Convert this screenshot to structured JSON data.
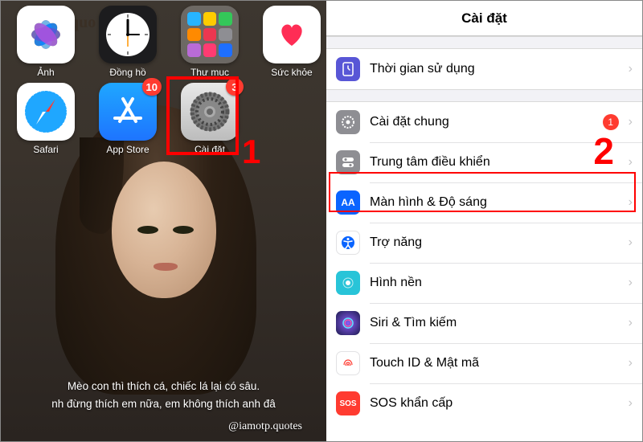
{
  "left": {
    "overlay_text": "quo",
    "apps_row1": [
      {
        "label": "Ảnh",
        "name": "photos"
      },
      {
        "label": "Đồng hồ",
        "name": "clock"
      },
      {
        "label": "Thư mục",
        "name": "folder"
      },
      {
        "label": "Sức khỏe",
        "name": "health"
      }
    ],
    "apps_row2": [
      {
        "label": "Safari",
        "name": "safari",
        "badge": null
      },
      {
        "label": "App Store",
        "name": "app-store",
        "badge": "10"
      },
      {
        "label": "Cài đặt",
        "name": "settings",
        "badge": "3"
      }
    ],
    "caption_line1": "Mèo con thì thích cá, chiếc lá lại có sâu.",
    "caption_line2": "nh đừng thích em nữa, em không thích anh đâ",
    "watermark": "@iamotp.quotes",
    "step_label": "1"
  },
  "right": {
    "title": "Cài đặt",
    "step_label": "2",
    "group1": [
      {
        "label": "Thời gian sử dụng",
        "icon": "screen-time",
        "badge": null
      }
    ],
    "group2": [
      {
        "label": "Cài đặt chung",
        "icon": "general",
        "badge": "1"
      },
      {
        "label": "Trung tâm điều khiển",
        "icon": "control-center",
        "badge": null
      },
      {
        "label": "Màn hình & Độ sáng",
        "icon": "display",
        "badge": null,
        "highlighted": true
      },
      {
        "label": "Trợ năng",
        "icon": "accessibility",
        "badge": null
      },
      {
        "label": "Hình nền",
        "icon": "wallpaper",
        "badge": null
      },
      {
        "label": "Siri & Tìm kiếm",
        "icon": "siri",
        "badge": null
      },
      {
        "label": "Touch ID & Mật mã",
        "icon": "touch-id",
        "badge": null
      },
      {
        "label": "SOS khẩn cấp",
        "icon": "sos",
        "badge": null
      }
    ]
  },
  "colors": {
    "red": "#ff0000"
  }
}
